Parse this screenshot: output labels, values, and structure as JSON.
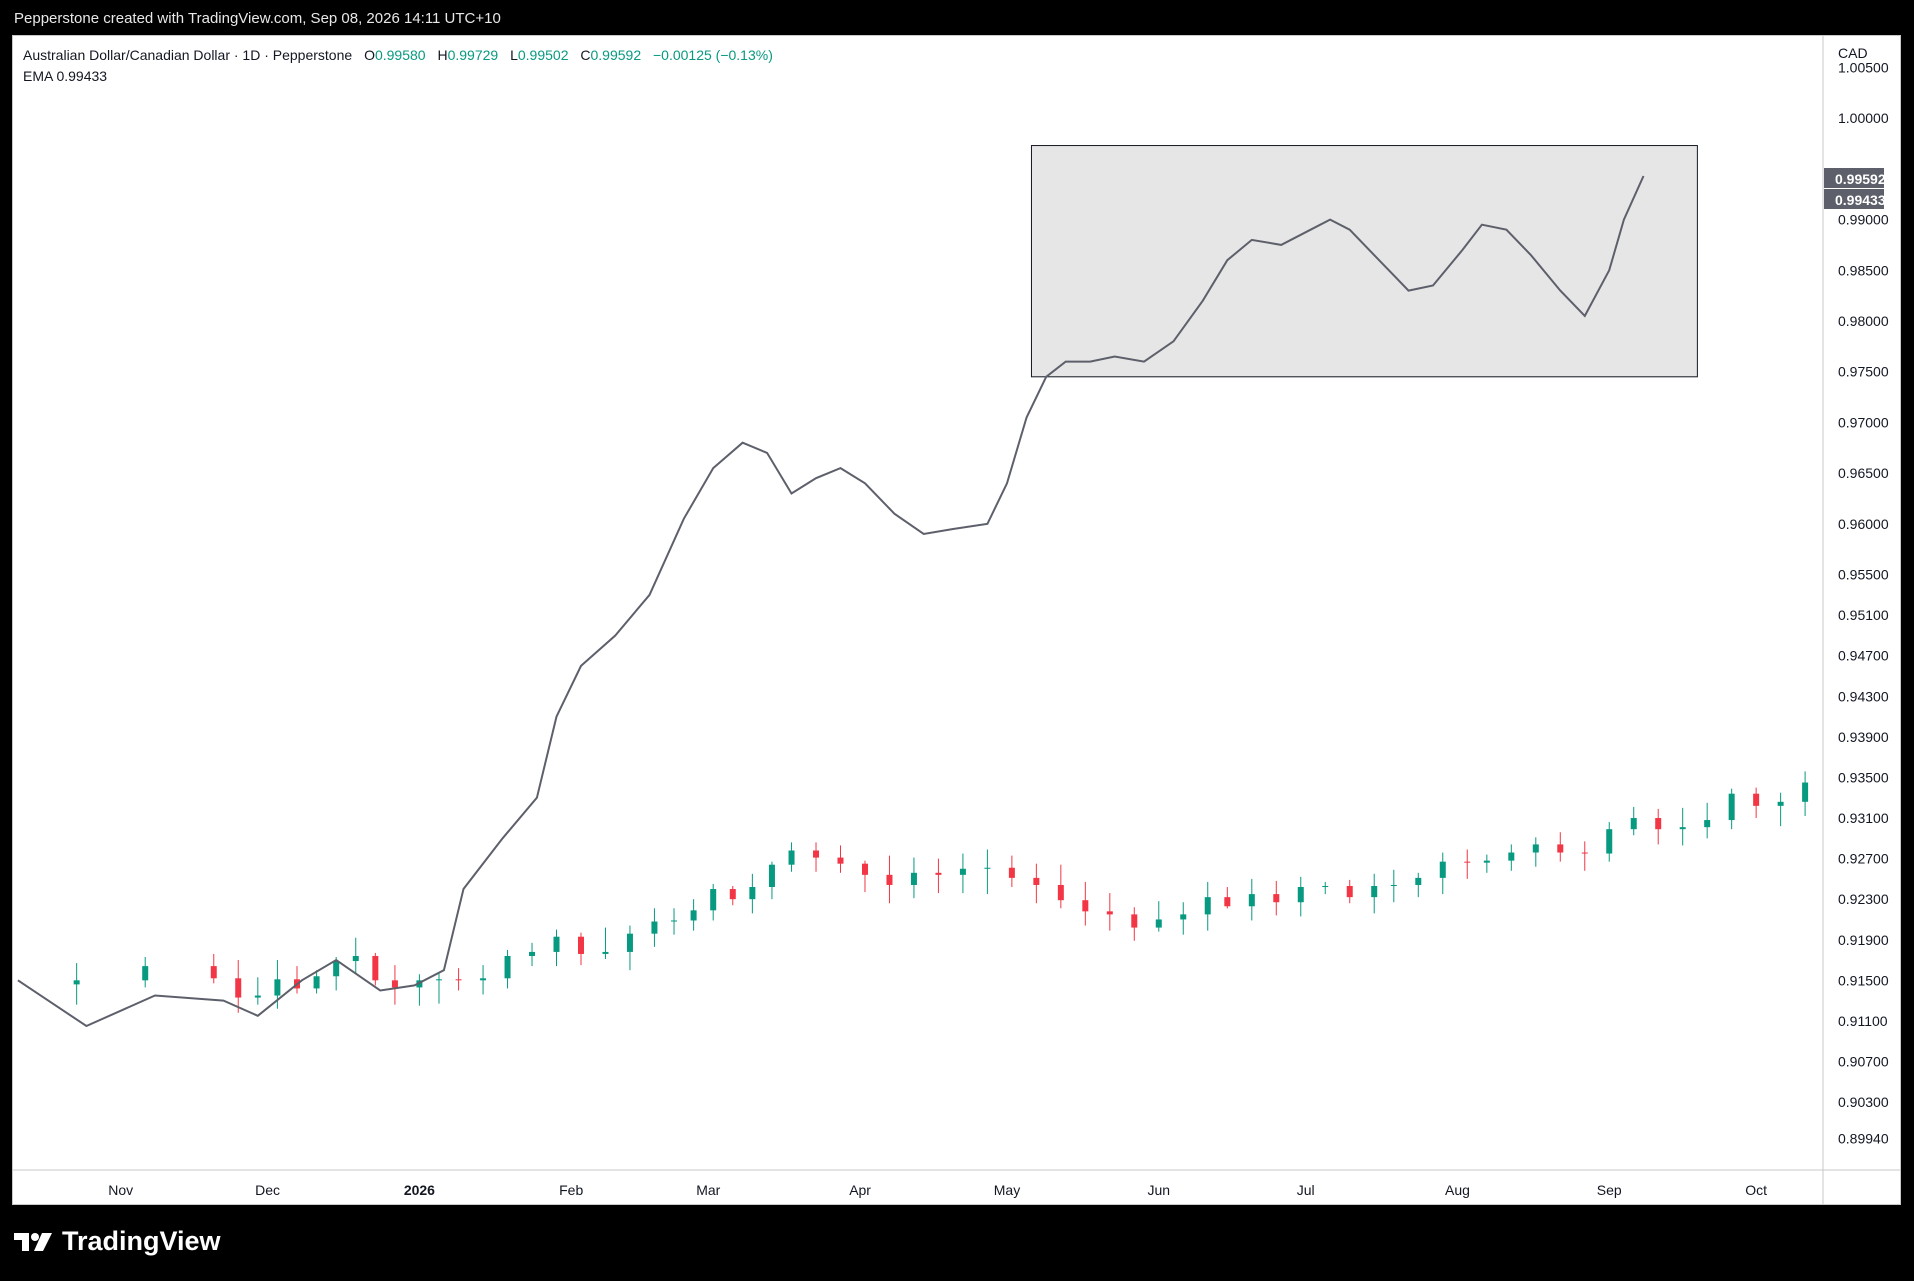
{
  "attribution": "Pepperstone created with TradingView.com, Sep 08, 2026 14:11 UTC+10",
  "legend": {
    "symbol": "Australian Dollar/Canadian Dollar · 1D · Pepperstone",
    "open_label": "O",
    "open": "0.99580",
    "high_label": "H",
    "high": "0.99729",
    "low_label": "L",
    "low": "0.99502",
    "close_label": "C",
    "close": "0.99592",
    "change": "−0.00125 (−0.13%)",
    "ema_label": "EMA",
    "ema_value": "0.99433"
  },
  "brand": {
    "name": "TradingView",
    "logo_icon": "tradingview-logo-icon"
  },
  "colors": {
    "up": "#089981",
    "down": "#F23645",
    "ema": "#5d606b",
    "box_fill": "#e6e6e6",
    "box_border": "#131722",
    "text": "#131722"
  },
  "chart_data": {
    "type": "candlestick",
    "currency": "CAD",
    "ylim": [
      0.8963,
      1.0081
    ],
    "y_ticks": [
      "1.00500",
      "1.00000",
      "0.99000",
      "0.98500",
      "0.98000",
      "0.97500",
      "0.97000",
      "0.96500",
      "0.96000",
      "0.95500",
      "0.95100",
      "0.94700",
      "0.94300",
      "0.93900",
      "0.93500",
      "0.93100",
      "0.92700",
      "0.92300",
      "0.91900",
      "0.91500",
      "0.91100",
      "0.90700",
      "0.90300",
      "0.89940"
    ],
    "x_labels": [
      {
        "label": "Nov",
        "date": "2025-11-01",
        "bold": false
      },
      {
        "label": "Dec",
        "date": "2025-12-01",
        "bold": false
      },
      {
        "label": "2026",
        "date": "2026-01-01",
        "bold": true
      },
      {
        "label": "Feb",
        "date": "2026-02-01",
        "bold": false
      },
      {
        "label": "Mar",
        "date": "2026-03-01",
        "bold": false
      },
      {
        "label": "Apr",
        "date": "2026-04-01",
        "bold": false
      },
      {
        "label": "May",
        "date": "2026-05-01",
        "bold": false
      },
      {
        "label": "Jun",
        "date": "2026-06-01",
        "bold": false
      },
      {
        "label": "Jul",
        "date": "2026-07-01",
        "bold": false
      },
      {
        "label": "Aug",
        "date": "2026-08-01",
        "bold": false
      },
      {
        "label": "Sep",
        "date": "2026-09-01",
        "bold": false
      },
      {
        "label": "Oct",
        "date": "2026-10-01",
        "bold": false
      }
    ],
    "x_range": [
      "2025-10-10",
      "2026-10-12"
    ],
    "last_price_label": "0.99592",
    "ema_price_label": "0.99433",
    "range_box": {
      "start": "2026-05-06",
      "end": "2026-09-19",
      "top": 0.9973,
      "bottom": 0.9745
    },
    "ema": [
      [
        "2025-10-11",
        0.915
      ],
      [
        "2025-10-25",
        0.9105
      ],
      [
        "2025-11-08",
        0.9135
      ],
      [
        "2025-11-22",
        0.913
      ],
      [
        "2025-11-29",
        0.9115
      ],
      [
        "2025-12-08",
        0.915
      ],
      [
        "2025-12-15",
        0.917
      ],
      [
        "2025-12-24",
        0.914
      ],
      [
        "2025-12-31",
        0.9145
      ],
      [
        "2026-01-06",
        0.916
      ],
      [
        "2026-01-10",
        0.924
      ],
      [
        "2026-01-18",
        0.929
      ],
      [
        "2026-01-25",
        0.933
      ],
      [
        "2026-01-29",
        0.941
      ],
      [
        "2026-02-03",
        0.946
      ],
      [
        "2026-02-10",
        0.949
      ],
      [
        "2026-02-17",
        0.953
      ],
      [
        "2026-02-24",
        0.9605
      ],
      [
        "2026-03-02",
        0.9655
      ],
      [
        "2026-03-08",
        0.968
      ],
      [
        "2026-03-13",
        0.967
      ],
      [
        "2026-03-18",
        0.963
      ],
      [
        "2026-03-23",
        0.9645
      ],
      [
        "2026-03-28",
        0.9655
      ],
      [
        "2026-04-02",
        0.964
      ],
      [
        "2026-04-08",
        0.961
      ],
      [
        "2026-04-14",
        0.959
      ],
      [
        "2026-04-20",
        0.9595
      ],
      [
        "2026-04-27",
        0.96
      ],
      [
        "2026-05-01",
        0.964
      ],
      [
        "2026-05-05",
        0.9705
      ],
      [
        "2026-05-09",
        0.9745
      ],
      [
        "2026-05-13",
        0.976
      ],
      [
        "2026-05-18",
        0.976
      ],
      [
        "2026-05-23",
        0.9765
      ],
      [
        "2026-05-29",
        0.976
      ],
      [
        "2026-06-04",
        0.978
      ],
      [
        "2026-06-10",
        0.982
      ],
      [
        "2026-06-15",
        0.986
      ],
      [
        "2026-06-20",
        0.988
      ],
      [
        "2026-06-26",
        0.9875
      ],
      [
        "2026-07-02",
        0.989
      ],
      [
        "2026-07-06",
        0.99
      ],
      [
        "2026-07-10",
        0.989
      ],
      [
        "2026-07-16",
        0.986
      ],
      [
        "2026-07-22",
        0.983
      ],
      [
        "2026-07-27",
        0.9835
      ],
      [
        "2026-08-02",
        0.987
      ],
      [
        "2026-08-06",
        0.9895
      ],
      [
        "2026-08-11",
        0.989
      ],
      [
        "2026-08-16",
        0.9865
      ],
      [
        "2026-08-22",
        0.983
      ],
      [
        "2026-08-27",
        0.9805
      ],
      [
        "2026-09-01",
        0.985
      ],
      [
        "2026-09-04",
        0.99
      ],
      [
        "2026-09-08",
        0.9943
      ]
    ],
    "candles": [
      [
        "2025-10-09",
        0.9148,
        0.9154,
        0.912,
        0.9146
      ],
      [
        "2025-10-23",
        0.9146,
        0.9167,
        0.9126,
        0.915
      ],
      [
        "2025-11-06",
        0.915,
        0.9173,
        0.9143,
        0.9164
      ],
      [
        "2025-11-20",
        0.9164,
        0.9176,
        0.9147,
        0.9152
      ],
      [
        "2025-11-25",
        0.9152,
        0.917,
        0.9118,
        0.9133
      ],
      [
        "2025-11-29",
        0.9133,
        0.9153,
        0.9126,
        0.9135
      ],
      [
        "2025-12-03",
        0.9135,
        0.917,
        0.9122,
        0.9151
      ],
      [
        "2025-12-07",
        0.9151,
        0.9164,
        0.9137,
        0.9142
      ],
      [
        "2025-12-11",
        0.9142,
        0.916,
        0.9137,
        0.9154
      ],
      [
        "2025-12-15",
        0.9154,
        0.9173,
        0.914,
        0.9169
      ],
      [
        "2025-12-19",
        0.9169,
        0.9192,
        0.9156,
        0.9174
      ],
      [
        "2025-12-23",
        0.9174,
        0.9177,
        0.9145,
        0.915
      ],
      [
        "2025-12-27",
        0.915,
        0.9165,
        0.9126,
        0.9143
      ],
      [
        "2026-01-01",
        0.9143,
        0.9156,
        0.9125,
        0.915
      ],
      [
        "2026-01-05",
        0.915,
        0.9158,
        0.9127,
        0.9151
      ],
      [
        "2026-01-09",
        0.9151,
        0.9162,
        0.914,
        0.915
      ],
      [
        "2026-01-14",
        0.915,
        0.9165,
        0.9136,
        0.9152
      ],
      [
        "2026-01-19",
        0.9152,
        0.918,
        0.9142,
        0.9174
      ],
      [
        "2026-01-24",
        0.9174,
        0.9187,
        0.9164,
        0.9178
      ],
      [
        "2026-01-29",
        0.9178,
        0.92,
        0.9164,
        0.9193
      ],
      [
        "2026-02-03",
        0.9193,
        0.9197,
        0.9165,
        0.9176
      ],
      [
        "2026-02-08",
        0.9176,
        0.9202,
        0.9171,
        0.9178
      ],
      [
        "2026-02-13",
        0.9178,
        0.9204,
        0.916,
        0.9196
      ],
      [
        "2026-02-18",
        0.9196,
        0.9221,
        0.9183,
        0.9208
      ],
      [
        "2026-02-22",
        0.9208,
        0.9221,
        0.9195,
        0.9209
      ],
      [
        "2026-02-26",
        0.9209,
        0.923,
        0.9199,
        0.9219
      ],
      [
        "2026-03-02",
        0.9219,
        0.9245,
        0.9209,
        0.924
      ],
      [
        "2026-03-06",
        0.924,
        0.9243,
        0.9224,
        0.923
      ],
      [
        "2026-03-10",
        0.923,
        0.9255,
        0.9216,
        0.9242
      ],
      [
        "2026-03-14",
        0.9242,
        0.9267,
        0.923,
        0.9264
      ],
      [
        "2026-03-18",
        0.9264,
        0.9286,
        0.9257,
        0.9278
      ],
      [
        "2026-03-23",
        0.9278,
        0.9286,
        0.9257,
        0.9271
      ],
      [
        "2026-03-28",
        0.9271,
        0.9283,
        0.9256,
        0.9265
      ],
      [
        "2026-04-02",
        0.9265,
        0.9268,
        0.9237,
        0.9254
      ],
      [
        "2026-04-07",
        0.9254,
        0.9273,
        0.9226,
        0.9244
      ],
      [
        "2026-04-12",
        0.9244,
        0.9271,
        0.9231,
        0.9256
      ],
      [
        "2026-04-17",
        0.9256,
        0.927,
        0.9236,
        0.9254
      ],
      [
        "2026-04-22",
        0.9254,
        0.9275,
        0.9236,
        0.926
      ],
      [
        "2026-04-27",
        0.926,
        0.9279,
        0.9235,
        0.9261
      ],
      [
        "2026-05-02",
        0.9261,
        0.9273,
        0.9242,
        0.9251
      ],
      [
        "2026-05-07",
        0.9251,
        0.9265,
        0.9226,
        0.9244
      ],
      [
        "2026-05-12",
        0.9244,
        0.9264,
        0.9221,
        0.9229
      ],
      [
        "2026-05-17",
        0.9229,
        0.9247,
        0.9204,
        0.9218
      ],
      [
        "2026-05-22",
        0.9218,
        0.9236,
        0.9199,
        0.9215
      ],
      [
        "2026-05-27",
        0.9215,
        0.9222,
        0.9189,
        0.9202
      ],
      [
        "2026-06-01",
        0.9202,
        0.9228,
        0.9198,
        0.921
      ],
      [
        "2026-06-06",
        0.921,
        0.9227,
        0.9195,
        0.9215
      ],
      [
        "2026-06-11",
        0.9215,
        0.9247,
        0.9199,
        0.9232
      ],
      [
        "2026-06-15",
        0.9232,
        0.9242,
        0.9221,
        0.9223
      ],
      [
        "2026-06-20",
        0.9223,
        0.925,
        0.9209,
        0.9235
      ],
      [
        "2026-06-25",
        0.9235,
        0.9248,
        0.9214,
        0.9227
      ],
      [
        "2026-06-30",
        0.9227,
        0.9252,
        0.9213,
        0.9242
      ],
      [
        "2026-07-05",
        0.9242,
        0.9247,
        0.9235,
        0.9243
      ],
      [
        "2026-07-10",
        0.9243,
        0.9249,
        0.9226,
        0.9232
      ],
      [
        "2026-07-15",
        0.9232,
        0.9255,
        0.9216,
        0.9243
      ],
      [
        "2026-07-19",
        0.9243,
        0.9259,
        0.9227,
        0.9244
      ],
      [
        "2026-07-24",
        0.9244,
        0.9256,
        0.9232,
        0.9251
      ],
      [
        "2026-07-29",
        0.9251,
        0.9276,
        0.9235,
        0.9267
      ],
      [
        "2026-08-03",
        0.9267,
        0.9279,
        0.925,
        0.9266
      ],
      [
        "2026-08-07",
        0.9266,
        0.9274,
        0.9256,
        0.9268
      ],
      [
        "2026-08-12",
        0.9268,
        0.9284,
        0.9258,
        0.9276
      ],
      [
        "2026-08-17",
        0.9276,
        0.9291,
        0.9262,
        0.9284
      ],
      [
        "2026-08-22",
        0.9284,
        0.9296,
        0.9267,
        0.9276
      ],
      [
        "2026-08-27",
        0.9276,
        0.9287,
        0.9258,
        0.9275
      ],
      [
        "2026-09-01",
        0.9275,
        0.9306,
        0.9267,
        0.9299
      ],
      [
        "2026-09-06",
        0.9299,
        0.9321,
        0.9293,
        0.931
      ],
      [
        "2026-09-11",
        0.931,
        0.9319,
        0.9284,
        0.9299
      ],
      [
        "2026-09-16",
        0.9299,
        0.932,
        0.9283,
        0.9301
      ],
      [
        "2026-09-21",
        0.9301,
        0.9325,
        0.929,
        0.9308
      ],
      [
        "2026-09-26",
        0.9308,
        0.9339,
        0.9299,
        0.9334
      ],
      [
        "2026-10-01",
        0.9334,
        0.934,
        0.931,
        0.9322
      ],
      [
        "2026-10-06",
        0.9322,
        0.9335,
        0.9302,
        0.9326
      ],
      [
        "2026-10-11",
        0.9326,
        0.9356,
        0.9312,
        0.9345
      ]
    ]
  }
}
